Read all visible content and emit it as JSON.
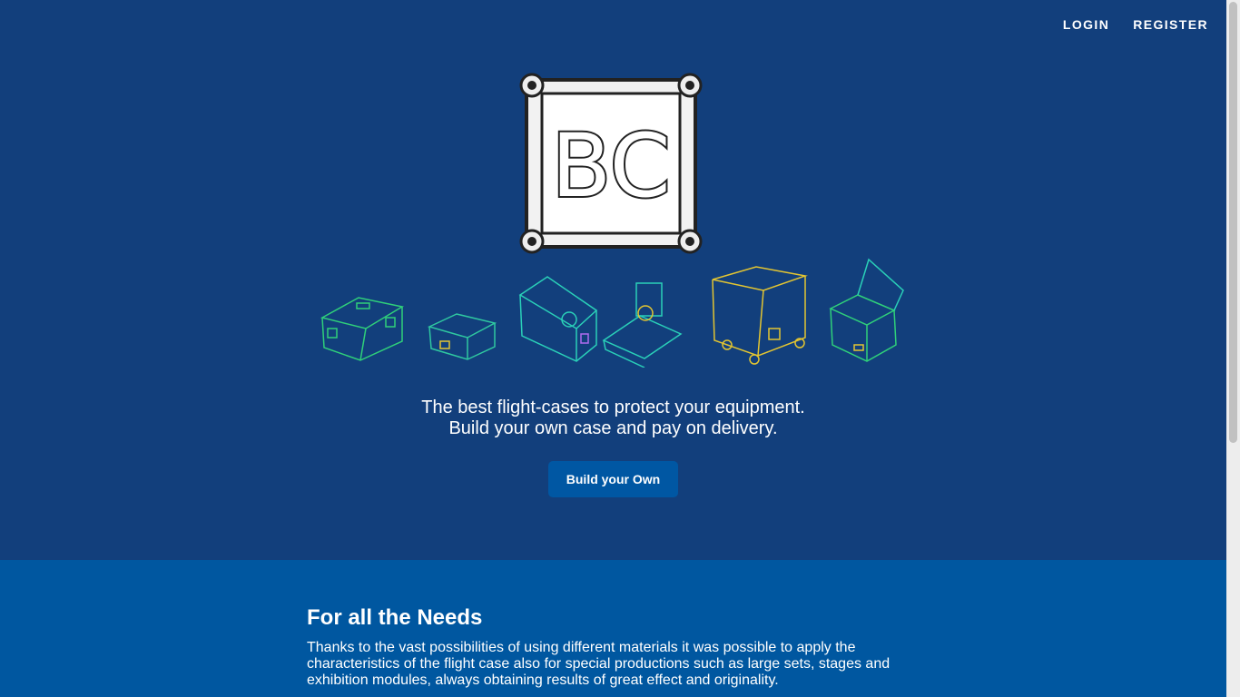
{
  "nav": {
    "login_label": "LOGIN",
    "register_label": "REGISTER"
  },
  "logo": {
    "text": "BC"
  },
  "hero": {
    "tagline_line1": "The best flight-cases to protect your equipment.",
    "tagline_line2": "Build your own case and pay on delivery.",
    "cta_label": "Build your Own"
  },
  "section": {
    "heading": "For all the Needs",
    "body": "Thanks to the vast possibilities of using different materials it was possible to apply the characteristics of the flight case also for special productions such as large sets, stages and exhibition modules, always obtaining results of great effect and originality."
  },
  "colors": {
    "hero_bg": "#123f7c",
    "section_bg": "#0057a0",
    "button_bg": "#0057a3",
    "case_green": "#2fd07a",
    "case_teal": "#2ad0b8",
    "case_yellow": "#e3c531"
  }
}
